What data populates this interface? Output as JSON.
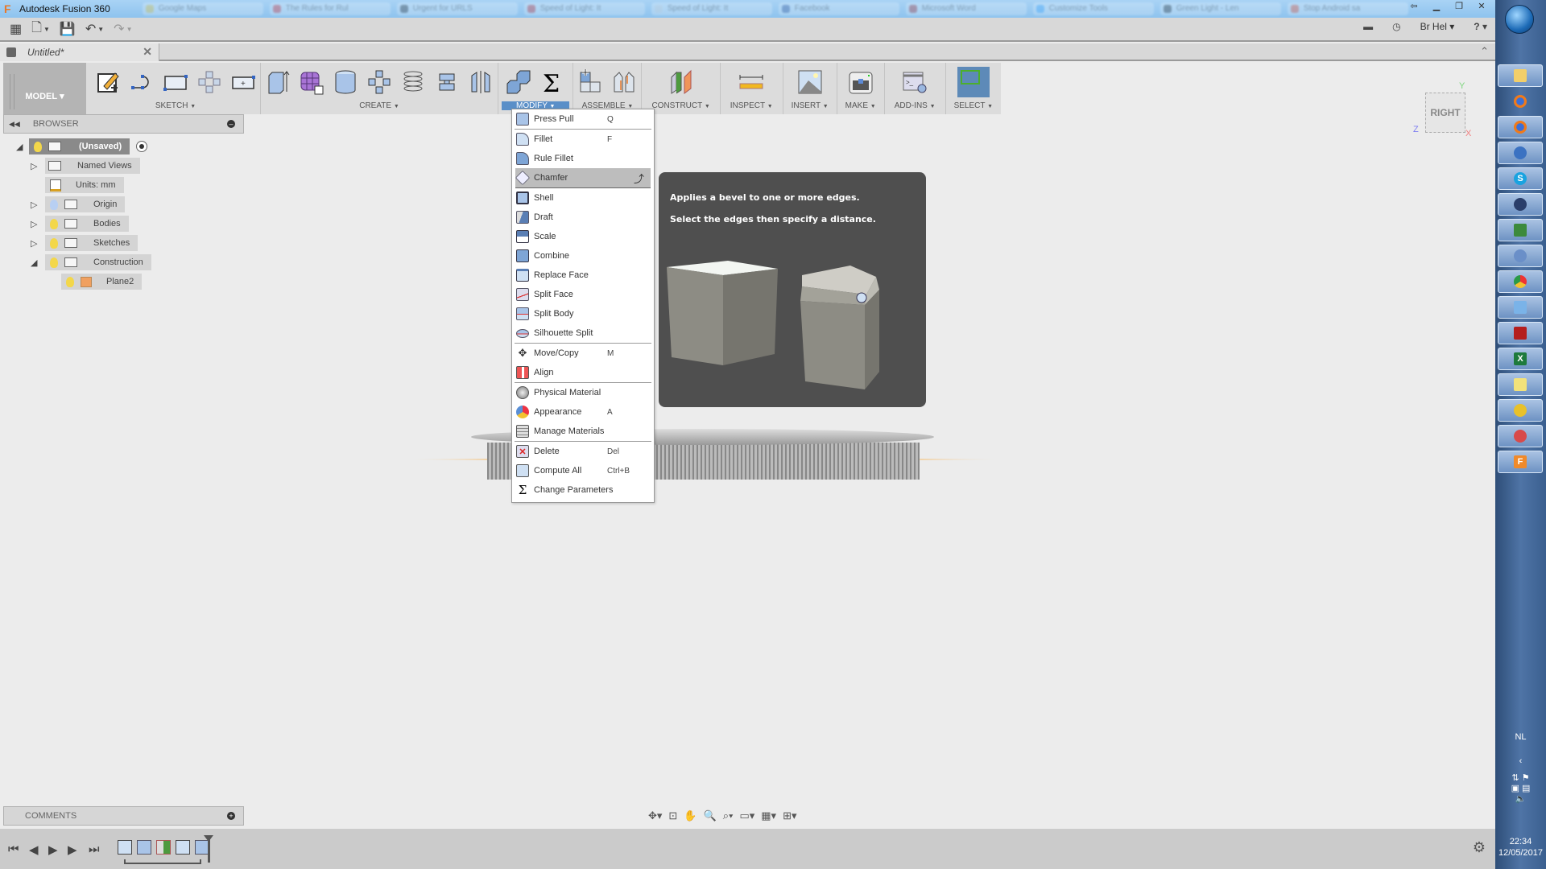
{
  "window": {
    "title": "Autodesk Fusion 360",
    "background_tabs": [
      "Google Maps",
      "The Rules for Rul",
      "Urgent for URLS",
      "Speed of Light: It",
      "Speed of Light: It",
      "Facebook",
      "Microsoft Word",
      "Customize Tools",
      "Green Light - Len",
      "Stop Android sa"
    ]
  },
  "quick_access": {
    "user": "Br Hel",
    "help_label": "?"
  },
  "document": {
    "tab_name": "Untitled*"
  },
  "ribbon": {
    "workspace": "MODEL",
    "groups": [
      {
        "label": "SKETCH",
        "icons": [
          "sketch-create-icon",
          "arc-icon",
          "rectangle-icon",
          "pattern-icon",
          "stop-sketch-icon"
        ]
      },
      {
        "label": "CREATE",
        "icons": [
          "extrude-icon",
          "form-icon",
          "cylinder-icon",
          "pattern-icon",
          "coil-icon",
          "sweep-icon",
          "mirror-icon"
        ]
      },
      {
        "label": "MODIFY",
        "icons": [
          "combine-icon",
          "sigma-icon"
        ],
        "active": true
      },
      {
        "label": "ASSEMBLE",
        "icons": [
          "new-component-icon",
          "joint-icon"
        ]
      },
      {
        "label": "CONSTRUCT",
        "icons": [
          "plane-icon"
        ]
      },
      {
        "label": "INSPECT",
        "icons": [
          "measure-icon"
        ]
      },
      {
        "label": "INSERT",
        "icons": [
          "image-icon"
        ]
      },
      {
        "label": "MAKE",
        "icons": [
          "3d-print-icon"
        ]
      },
      {
        "label": "ADD-INS",
        "icons": [
          "scripts-icon"
        ]
      },
      {
        "label": "SELECT",
        "icons": [
          "select-icon"
        ]
      }
    ]
  },
  "viewcube": {
    "face": "RIGHT",
    "x": "X",
    "y": "Y",
    "z": "Z"
  },
  "browser": {
    "title": "BROWSER",
    "root": "(Unsaved)",
    "items": [
      {
        "label": "Named Views",
        "expandable": true
      },
      {
        "label": "Units: mm",
        "expandable": false
      },
      {
        "label": "Origin",
        "expandable": true
      },
      {
        "label": "Bodies",
        "expandable": true
      },
      {
        "label": "Sketches",
        "expandable": true
      },
      {
        "label": "Construction",
        "expandable": true,
        "expanded": true
      },
      {
        "label": "Plane2",
        "expandable": false
      }
    ]
  },
  "modify_menu": {
    "items": [
      {
        "label": "Press Pull",
        "shortcut": "Q"
      },
      {
        "label": "Fillet",
        "shortcut": "F"
      },
      {
        "label": "Rule Fillet",
        "shortcut": ""
      },
      {
        "label": "Chamfer",
        "shortcut": "",
        "highlighted": true
      },
      {
        "label": "Shell",
        "shortcut": ""
      },
      {
        "label": "Draft",
        "shortcut": ""
      },
      {
        "label": "Scale",
        "shortcut": ""
      },
      {
        "label": "Combine",
        "shortcut": ""
      },
      {
        "label": "Replace Face",
        "shortcut": ""
      },
      {
        "label": "Split Face",
        "shortcut": ""
      },
      {
        "label": "Split Body",
        "shortcut": ""
      },
      {
        "label": "Silhouette Split",
        "shortcut": ""
      },
      {
        "label": "Move/Copy",
        "shortcut": "M"
      },
      {
        "label": "Align",
        "shortcut": ""
      },
      {
        "label": "Physical Material",
        "shortcut": ""
      },
      {
        "label": "Appearance",
        "shortcut": "A"
      },
      {
        "label": "Manage Materials",
        "shortcut": ""
      },
      {
        "label": "Delete",
        "shortcut": "Del"
      },
      {
        "label": "Compute All",
        "shortcut": "Ctrl+B"
      },
      {
        "label": "Change Parameters",
        "shortcut": ""
      }
    ]
  },
  "tooltip": {
    "line1": "Applies a bevel to one or more edges.",
    "line2": "Select the edges then specify a distance."
  },
  "comments": {
    "title": "COMMENTS"
  },
  "taskbar": {
    "language": "NL",
    "time": "22:34",
    "date": "12/05/2017"
  }
}
